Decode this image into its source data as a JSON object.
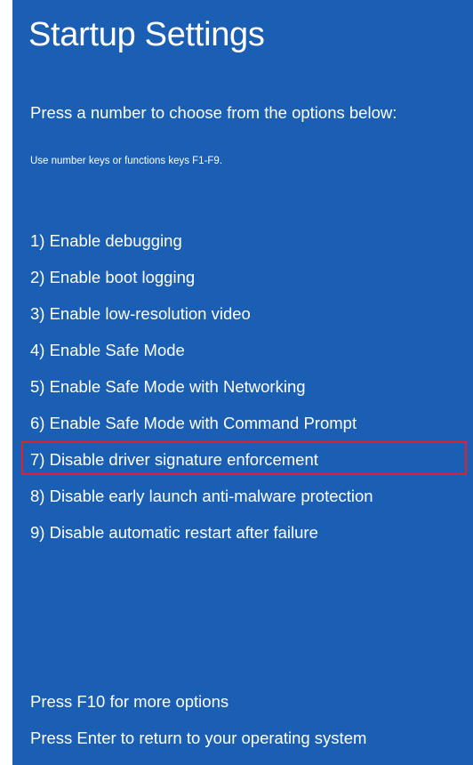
{
  "screen": {
    "title": "Startup Settings",
    "instruction": "Press a number to choose from the options below:",
    "hint": "Use number keys or functions keys F1-F9.",
    "background_color": "#1a5fb4",
    "highlight_color": "#e0222c"
  },
  "options": [
    {
      "label": "1) Enable debugging"
    },
    {
      "label": "2) Enable boot logging"
    },
    {
      "label": "3) Enable low-resolution video"
    },
    {
      "label": "4) Enable Safe Mode"
    },
    {
      "label": "5) Enable Safe Mode with Networking"
    },
    {
      "label": "6) Enable Safe Mode with Command Prompt"
    },
    {
      "label": "7) Disable driver signature enforcement",
      "highlighted": true
    },
    {
      "label": "8) Disable early launch anti-malware protection"
    },
    {
      "label": "9) Disable automatic restart after failure"
    }
  ],
  "footer": {
    "more_options": "Press F10 for more options",
    "return_os": "Press Enter to return to your operating system"
  }
}
